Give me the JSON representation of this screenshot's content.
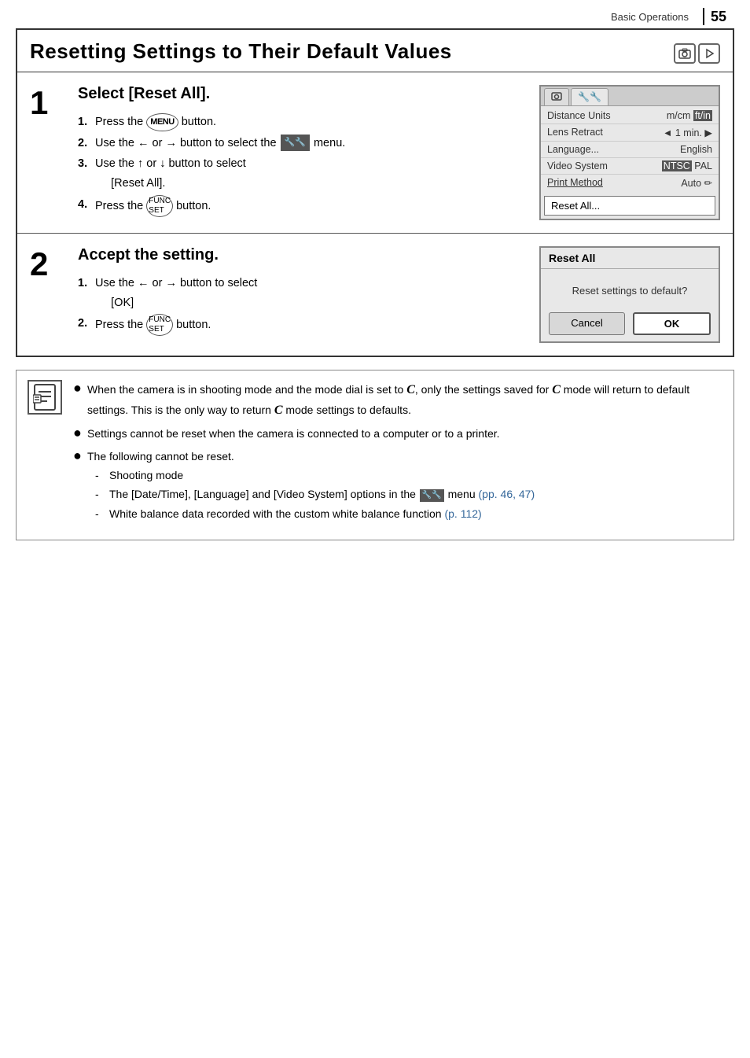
{
  "header": {
    "section": "Basic Operations",
    "page_number": "55"
  },
  "title": "Resetting Settings to Their Default Values",
  "mode_icons": [
    "camera",
    "play"
  ],
  "step1": {
    "number": "1",
    "title": "Select [Reset All].",
    "instructions": [
      {
        "num": "1.",
        "text": "Press the ",
        "icon": "MENU",
        "text2": " button."
      },
      {
        "num": "2.",
        "text": "Use the ← or → button to select the ",
        "icon": "wrench",
        "text2": " menu."
      },
      {
        "num": "3.",
        "text": "Use the ↑ or ↓ button to select [Reset All]."
      },
      {
        "num": "4.",
        "text": "Press the ",
        "icon": "FUNC/SET",
        "text2": " button."
      }
    ],
    "menu": {
      "tabs": [
        "camera",
        "wrench"
      ],
      "rows": [
        {
          "key": "Distance Units",
          "val": "m/cm",
          "val2": "ft/in",
          "val2_selected": true
        },
        {
          "key": "Lens Retract",
          "val": "◄ 1 min.",
          "arrow": true
        },
        {
          "key": "Language...",
          "val": "English"
        },
        {
          "key": "Video System",
          "val": "NTSC",
          "val2": "PAL",
          "val2_selected": true
        },
        {
          "key": "Print Method",
          "val": "Auto",
          "has_icon": true
        }
      ],
      "reset_row": "Reset All..."
    }
  },
  "step2": {
    "number": "2",
    "title": "Accept the setting.",
    "instructions": [
      {
        "num": "1.",
        "text": "Use the ← or → button to select [OK]"
      },
      {
        "num": "2.",
        "text": "Press the ",
        "icon": "FUNC/SET",
        "text2": " button."
      }
    ],
    "dialog": {
      "title": "Reset All",
      "body": "Reset settings to default?",
      "cancel": "Cancel",
      "ok": "OK"
    }
  },
  "notes": [
    {
      "bullet": "●",
      "text": "When the camera is in shooting mode and the mode dial is set to C, only the settings saved for C mode will return to default settings. This is the only way to return C mode settings to defaults."
    },
    {
      "bullet": "●",
      "text": "Settings cannot be reset when the camera is connected to a computer or to a printer."
    },
    {
      "bullet": "●",
      "text": "The following cannot be reset.",
      "sub": [
        {
          "dash": "-",
          "text": "Shooting mode"
        },
        {
          "dash": "-",
          "text": "The [Date/Time], [Language] and [Video System] options in the ",
          "icon": "wrench",
          "text2": " menu ",
          "link": "(pp. 46, 47)"
        },
        {
          "dash": "-",
          "text": "White balance data recorded with the custom white balance function ",
          "link": "(p. 112)"
        }
      ]
    }
  ]
}
